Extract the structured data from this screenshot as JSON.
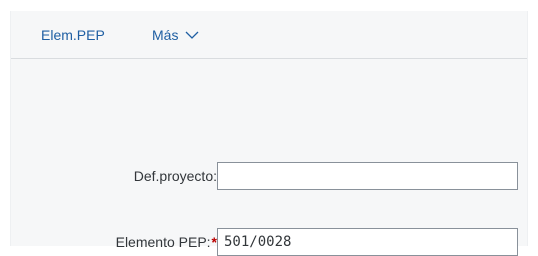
{
  "toolbar": {
    "elem_pep_label": "Elem.PEP",
    "mas_label": "Más",
    "mas_icon": "chevron-down-icon"
  },
  "form": {
    "def_proyecto": {
      "label": "Def.proyecto:",
      "value": ""
    },
    "elemento_pep": {
      "label": "Elemento PEP:",
      "required_marker": "*",
      "value": "501/0028"
    }
  },
  "colors": {
    "link": "#1f5fa3",
    "required": "#bb0000",
    "panel_bg": "#f6f7f8",
    "field_border": "#89919a"
  }
}
